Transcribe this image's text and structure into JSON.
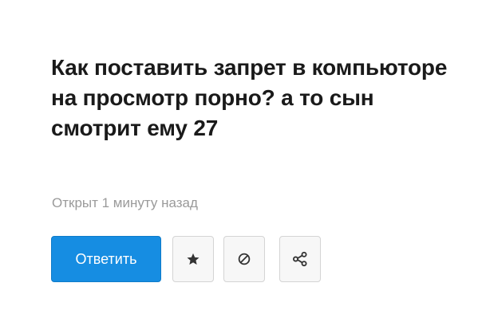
{
  "question": {
    "title": "Как поставить запрет в компьюторе на просмотр порно? а то сын смотрит ему 27",
    "status": "Открыт 1 минуту назад"
  },
  "actions": {
    "answer_label": "Ответить",
    "buttons": [
      {
        "icon": "star-icon"
      },
      {
        "icon": "block-icon"
      },
      {
        "icon": "share-icon"
      }
    ]
  },
  "colors": {
    "primary_button": "#168de2",
    "title_text": "#1a1a1a",
    "muted_text": "#9a9a9a",
    "icon_button_bg": "#f7f7f7",
    "icon_color": "#333333"
  }
}
